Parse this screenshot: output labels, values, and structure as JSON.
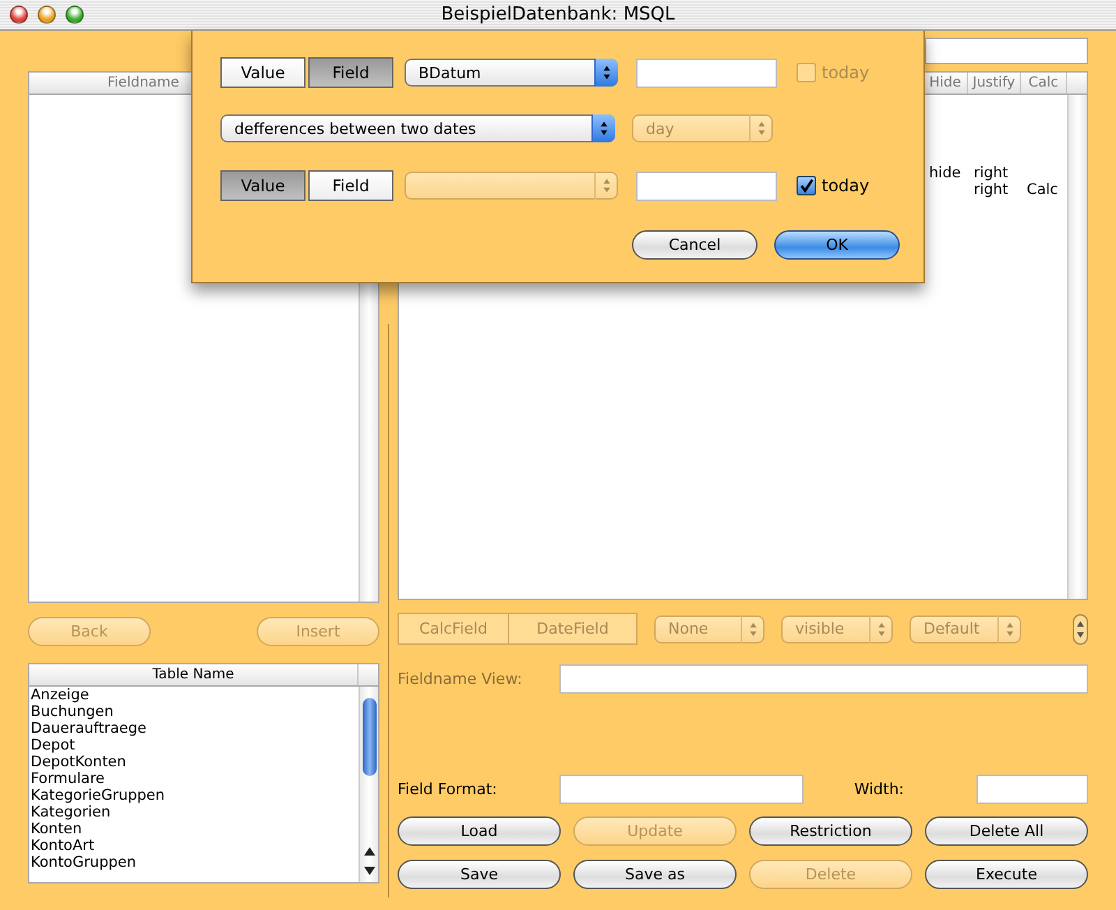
{
  "window": {
    "title": "BeispielDatenbank: MSQL"
  },
  "field_list": {
    "header": "Fieldname"
  },
  "nav_buttons": [
    {
      "label": "Back",
      "disabled": true
    },
    {
      "label": "Insert",
      "disabled": true
    }
  ],
  "table_list": {
    "header": "Table Name",
    "items": [
      "Anzeige",
      "Buchungen",
      "Dauerauftraege",
      "Depot",
      "DepotKonten",
      "Formulare",
      "KategorieGruppen",
      "Kategorien",
      "Konten",
      "KontoArt",
      "KontoGruppen"
    ]
  },
  "columns_table": {
    "columns": [
      "Hide",
      "Justify",
      "Calc"
    ],
    "rows": [
      [
        "hide",
        "right",
        ""
      ],
      [
        "",
        "right",
        "Calc"
      ]
    ]
  },
  "field_kinds": {
    "disabled": true,
    "items": [
      {
        "label": "CalcField",
        "selected": false
      },
      {
        "label": "DateField",
        "selected": false
      }
    ]
  },
  "popups": [
    {
      "value": "None",
      "disabled": true
    },
    {
      "value": "visible",
      "disabled": true
    },
    {
      "value": "Default",
      "disabled": true
    }
  ],
  "fieldname_view": {
    "label": "Fieldname View:"
  },
  "field_format": {
    "label": "Field Format:"
  },
  "width": {
    "label": "Width:"
  },
  "buttons": [
    {
      "label": "Load",
      "disabled": false
    },
    {
      "label": "Update",
      "disabled": true
    },
    {
      "label": "Restriction",
      "disabled": false
    },
    {
      "label": "Delete All",
      "disabled": false
    },
    {
      "label": "Save",
      "disabled": false
    },
    {
      "label": "Save as",
      "disabled": false
    },
    {
      "label": "Delete",
      "disabled": true
    },
    {
      "label": "Execute",
      "disabled": false
    }
  ],
  "dialog": {
    "operand_1": {
      "modes": [
        {
          "label": "Value",
          "selected": false
        },
        {
          "label": "Field",
          "selected": true
        }
      ],
      "field": {
        "value": "BDatum",
        "disabled": false
      },
      "today": {
        "label": "today",
        "checked": false,
        "disabled": true
      }
    },
    "operation": {
      "value": "defferences between two dates",
      "disabled": false
    },
    "unit": {
      "value": "day",
      "disabled": true
    },
    "operand_2": {
      "modes": [
        {
          "label": "Value",
          "selected": true
        },
        {
          "label": "Field",
          "selected": false
        }
      ],
      "field": {
        "disabled": true
      },
      "today": {
        "label": "today",
        "checked": true,
        "disabled": false
      }
    },
    "buttons": [
      {
        "label": "Cancel",
        "default": false
      },
      {
        "label": "OK",
        "default": true
      }
    ]
  }
}
